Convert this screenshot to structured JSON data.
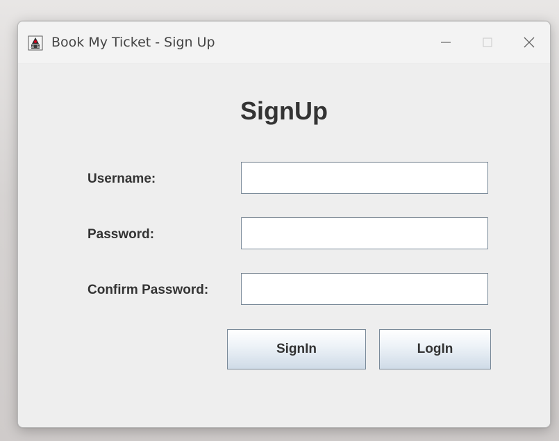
{
  "window": {
    "title": "Book My Ticket - Sign Up",
    "app_icon": "java-duke-icon",
    "controls": {
      "minimize_icon": "minimize-icon",
      "maximize_icon": "maximize-icon",
      "close_icon": "close-icon"
    }
  },
  "form": {
    "heading": "SignUp",
    "username_label": "Username:",
    "username_value": "",
    "password_label": "Password:",
    "password_value": "",
    "confirm_label": "Confirm Password:",
    "confirm_value": "",
    "signin_label": "SignIn",
    "login_label": "LogIn"
  },
  "colors": {
    "window_bg": "#eeeeee",
    "titlebar_bg": "#f3f3f3",
    "text": "#333333",
    "field_border": "#7a8a99",
    "button_gradient_bottom": "#cfdbe7"
  }
}
